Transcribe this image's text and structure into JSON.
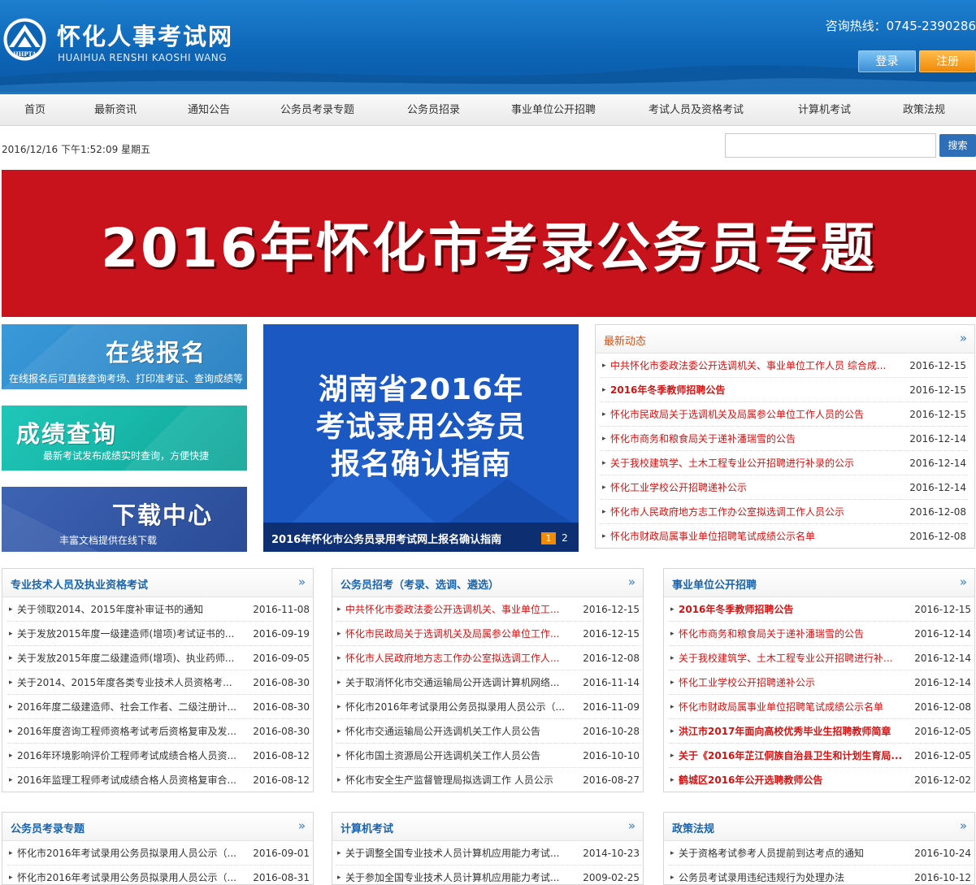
{
  "header": {
    "logo_text": "HHPTA",
    "title": "怀化人事考试网",
    "subtitle": "HUAIHUA RENSHI KAOSHI WANG",
    "hotline": "咨询热线：0745-2390286",
    "login": "登录",
    "register": "注册"
  },
  "nav": [
    "首页",
    "最新资讯",
    "通知公告",
    "公务员考录专题",
    "公务员招录",
    "事业单位公开招聘",
    "考试人员及资格考试",
    "计算机考试",
    "政策法规"
  ],
  "datetime": "2016/12/16 下午1:52:09 星期五",
  "search": {
    "placeholder": "",
    "button": "搜索"
  },
  "banner": {
    "text": "2016年怀化市考录公务员专题"
  },
  "quick": [
    {
      "title": "在线报名",
      "desc": "在线报名后可直接查询考场、打印准考证、查询成绩等"
    },
    {
      "title": "成绩查询",
      "desc": "最新考试发布成绩实时查询，方便快捷"
    },
    {
      "title": "下载中心",
      "desc": "丰富文档提供在线下载"
    }
  ],
  "slide": {
    "line1": "湖南省2016年",
    "line2": "考试录用公务员",
    "line3": "报名确认指南",
    "caption": "2016年怀化市公务员录用考试网上报名确认指南",
    "dot1": "1",
    "dot2": "2"
  },
  "panels": {
    "latest": {
      "title": "最新动态",
      "more": "»",
      "items": [
        {
          "title": "中共怀化市委政法委公开选调机关、事业单位工作人员 综合成...",
          "date": "2016-12-15"
        },
        {
          "title": "2016年冬季教师招聘公告",
          "date": "2016-12-15"
        },
        {
          "title": "怀化市民政局关于选调机关及局属参公单位工作人员的公告",
          "date": "2016-12-15"
        },
        {
          "title": "怀化市商务和粮食局关于递补潘瑞雪的公告",
          "date": "2016-12-14"
        },
        {
          "title": "关于我校建筑学、土木工程专业公开招聘进行补录的公示",
          "date": "2016-12-14"
        },
        {
          "title": "怀化工业学校公开招聘递补公示",
          "date": "2016-12-14"
        },
        {
          "title": "怀化市人民政府地方志工作办公室拟选调工作人员公示",
          "date": "2016-12-08"
        },
        {
          "title": "怀化市财政局属事业单位招聘笔试成绩公示名单",
          "date": "2016-12-08"
        }
      ]
    },
    "pro": {
      "title": "专业技术人员及执业资格考试",
      "more": "»",
      "items": [
        {
          "title": "关于领取2014、2015年度补审证书的通知",
          "date": "2016-11-08"
        },
        {
          "title": "关于发放2015年度一级建造师(增项)考试证书的...",
          "date": "2016-09-19"
        },
        {
          "title": "关于发放2015年度二级建造师(增项)、执业药师...",
          "date": "2016-09-05"
        },
        {
          "title": "关于2014、2015年度各类专业技术人员资格考...",
          "date": "2016-08-30"
        },
        {
          "title": "2016年度二级建造师、社会工作者、二级注册计...",
          "date": "2016-08-30"
        },
        {
          "title": "2016年度咨询工程师资格考试考后资格复审及发...",
          "date": "2016-08-30"
        },
        {
          "title": "2016年环境影响评价工程师考试成绩合格人员资...",
          "date": "2016-08-12"
        },
        {
          "title": "2016年监理工程师考试成绩合格人员资格复审合...",
          "date": "2016-08-12"
        }
      ]
    },
    "civil": {
      "title": "公务员招考（考录、选调、遴选）",
      "more": "»",
      "items": [
        {
          "title": "中共怀化市委政法委公开选调机关、事业单位工...",
          "date": "2016-12-15"
        },
        {
          "title": "怀化市民政局关于选调机关及局属参公单位工作...",
          "date": "2016-12-15"
        },
        {
          "title": "怀化市人民政府地方志工作办公室拟选调工作人...",
          "date": "2016-12-08"
        },
        {
          "title": "关于取消怀化市交通运输局公开选调计算机网络...",
          "date": "2016-11-14"
        },
        {
          "title": "怀化市2016年考试录用公务员拟录用人员公示（...",
          "date": "2016-11-09"
        },
        {
          "title": "怀化市交通运输局公开选调机关工作人员公告",
          "date": "2016-10-28"
        },
        {
          "title": "怀化市国土资源局公开选调机关工作人员公告",
          "date": "2016-10-10"
        },
        {
          "title": "怀化市安全生产监督管理局拟选调工作 人员公示",
          "date": "2016-08-27"
        }
      ]
    },
    "inst": {
      "title": "事业单位公开招聘",
      "more": "»",
      "items": [
        {
          "title": "2016年冬季教师招聘公告",
          "date": "2016-12-15"
        },
        {
          "title": "怀化市商务和粮食局关于递补潘瑞雪的公告",
          "date": "2016-12-14"
        },
        {
          "title": "关于我校建筑学、土木工程专业公开招聘进行补...",
          "date": "2016-12-14"
        },
        {
          "title": "怀化工业学校公开招聘递补公示",
          "date": "2016-12-14"
        },
        {
          "title": "怀化市财政局属事业单位招聘笔试成绩公示名单",
          "date": "2016-12-08"
        },
        {
          "title": "洪江市2017年面向高校优秀毕业生招聘教师简章",
          "date": "2016-12-05"
        },
        {
          "title": "关于《2016年芷江侗族自治县卫生和计划生育局...",
          "date": "2016-12-05"
        },
        {
          "title": "鹤城区2016年公开选聘教师公告",
          "date": "2016-12-02"
        }
      ]
    },
    "civtopic": {
      "title": "公务员考录专题",
      "more": "»",
      "items": [
        {
          "title": "怀化市2016年考试录用公务员拟录用人员公示（...",
          "date": "2016-09-01"
        },
        {
          "title": "怀化市2016年考试录用公务员拟录用人员公示（...",
          "date": "2016-08-31"
        }
      ]
    },
    "computer": {
      "title": "计算机考试",
      "more": "»",
      "items": [
        {
          "title": "关于调整全国专业技术人员计算机应用能力考试...",
          "date": "2014-10-23"
        },
        {
          "title": "关于参加全国专业技术人员计算机应用能力考试...",
          "date": "2009-02-25"
        }
      ]
    },
    "policy": {
      "title": "政策法规",
      "more": "»",
      "items": [
        {
          "title": "关于资格考试参考人员提前到达考点的通知",
          "date": "2016-10-24"
        },
        {
          "title": "公务员考试录用违纪违规行为处理办法",
          "date": "2016-10-12"
        }
      ]
    }
  },
  "colors": {
    "brand": "#0d64b5",
    "accent_red": "#c8121c",
    "link_red": "#d01313",
    "orange": "#f08a07"
  }
}
